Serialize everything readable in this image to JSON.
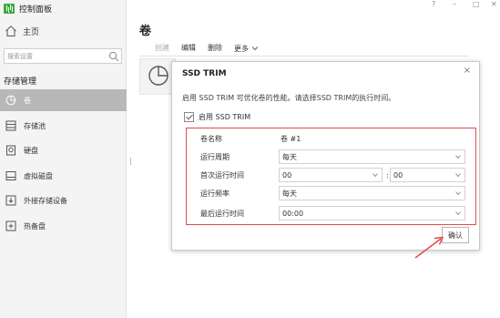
{
  "app": {
    "title": "控制面板"
  },
  "window_controls": {
    "help": "?",
    "minimize": "–",
    "maximize": "□",
    "close": "✕"
  },
  "sidebar": {
    "home_label": "主页",
    "search_placeholder": "搜索设置",
    "section_title": "存储管理",
    "items": [
      {
        "label": "卷",
        "icon": "pie-chart-icon",
        "active": true
      },
      {
        "label": "存储池",
        "icon": "storage-pool-icon",
        "active": false
      },
      {
        "label": "硬盘",
        "icon": "hard-disk-icon",
        "active": false
      },
      {
        "label": "虚拟磁盘",
        "icon": "virtual-disk-icon",
        "active": false
      },
      {
        "label": "外接存储设备",
        "icon": "external-storage-icon",
        "active": false
      },
      {
        "label": "热备盘",
        "icon": "hot-spare-icon",
        "active": false
      }
    ]
  },
  "main": {
    "title": "卷",
    "toolbar": {
      "create": "创建",
      "edit": "编辑",
      "delete": "删除",
      "more": "更多"
    }
  },
  "dialog": {
    "title": "SSD TRIM",
    "close": "×",
    "description": "启用 SSD TRIM 可优化卷的性能。请选择SSD TRIM的执行时间。",
    "enable_label": "启用 SSD TRIM",
    "enable_checked": true,
    "fields": {
      "volume_name_label": "卷名称",
      "volume_name_value": "卷 #1",
      "period_label": "运行周期",
      "period_value": "每天",
      "first_time_label": "首次运行时间",
      "first_time_hour": "00",
      "time_separator": ":",
      "first_time_minute": "00",
      "frequency_label": "运行频率",
      "frequency_value": "每天",
      "last_time_label": "最后运行时间",
      "last_time_value": "00:00"
    },
    "confirm_label": "确认"
  },
  "colors": {
    "accent_green": "#3cab3c",
    "highlight_red": "#e34b4b",
    "active_nav": "#b8b8b8"
  }
}
